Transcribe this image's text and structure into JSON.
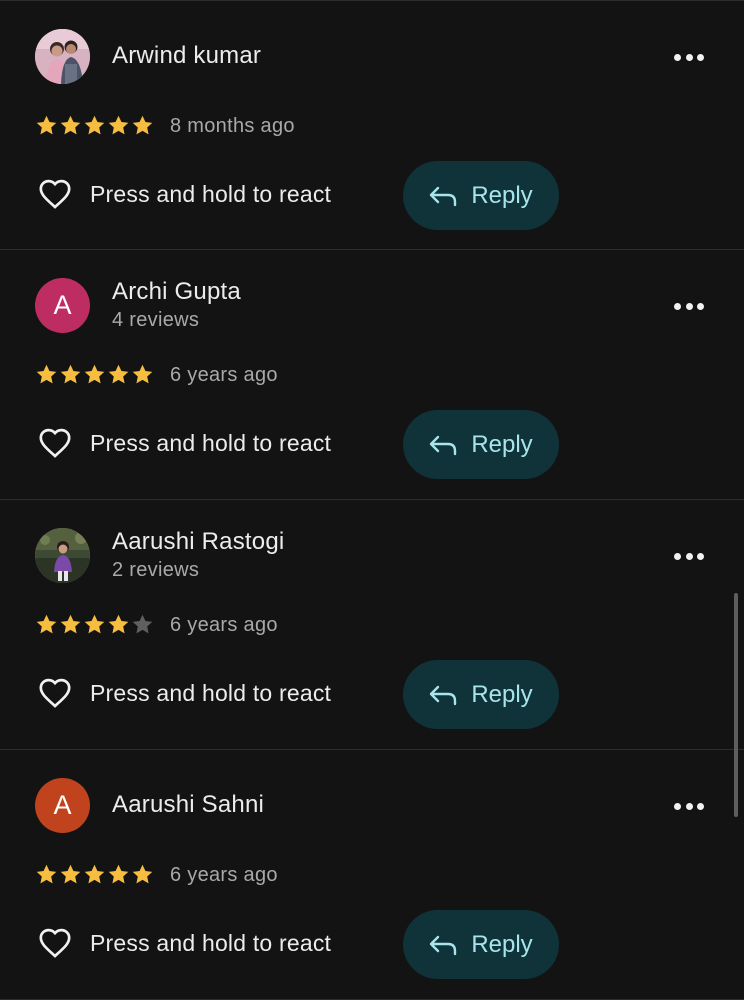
{
  "colors": {
    "background": "#131313",
    "star_filled": "#f6bd41",
    "star_empty": "#5f5f5f",
    "reply_bg": "#0f3338",
    "reply_text": "#a7e4ec"
  },
  "reviews": [
    {
      "name": "Arwind kumar",
      "subtitle": "",
      "avatar": {
        "type": "photo",
        "letter": "",
        "color": ""
      },
      "rating": 5,
      "time": "8 months ago",
      "react_label": "Press and hold to react",
      "reply_label": "Reply"
    },
    {
      "name": "Archi Gupta",
      "subtitle": "4 reviews",
      "avatar": {
        "type": "letter",
        "letter": "A",
        "color": "#bd2d62"
      },
      "rating": 5,
      "time": "6 years ago",
      "react_label": "Press and hold to react",
      "reply_label": "Reply"
    },
    {
      "name": "Aarushi Rastogi",
      "subtitle": "2 reviews",
      "avatar": {
        "type": "photo",
        "letter": "",
        "color": ""
      },
      "rating": 4,
      "time": "6 years ago",
      "react_label": "Press and hold to react",
      "reply_label": "Reply"
    },
    {
      "name": "Aarushi Sahni",
      "subtitle": "",
      "avatar": {
        "type": "letter",
        "letter": "A",
        "color": "#c0431e"
      },
      "rating": 5,
      "time": "6 years ago",
      "react_label": "Press and hold to react",
      "reply_label": "Reply"
    }
  ],
  "icons": {
    "more": "more-vert-icon",
    "star": "star-icon",
    "heart": "heart-outline-icon",
    "reply": "reply-arrow-icon"
  }
}
